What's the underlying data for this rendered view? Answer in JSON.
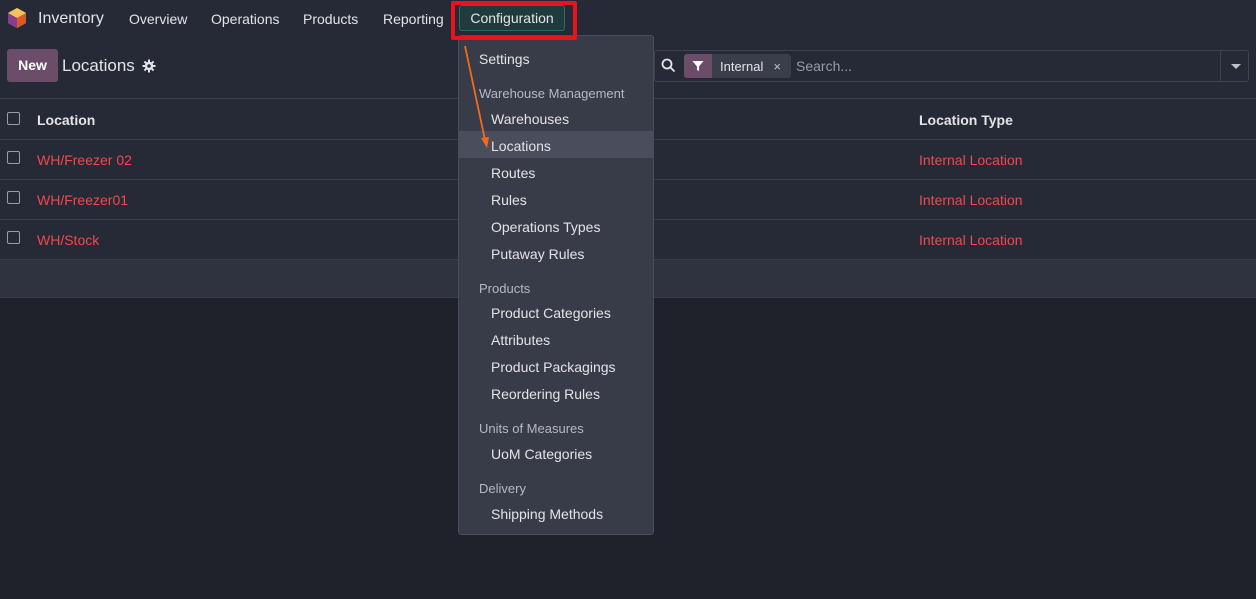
{
  "navbar": {
    "app_name": "Inventory",
    "menu": [
      "Overview",
      "Operations",
      "Products",
      "Reporting"
    ],
    "config_label": "Configuration"
  },
  "control_panel": {
    "new_label": "New",
    "title": "Locations",
    "facet_label": "Internal",
    "facet_remove": "×",
    "search_placeholder": "Search..."
  },
  "list": {
    "columns": [
      "Location",
      "Location Type"
    ],
    "rows": [
      {
        "location": "WH/Freezer 02",
        "type": "Internal Location"
      },
      {
        "location": "WH/Freezer01",
        "type": "Internal Location"
      },
      {
        "location": "WH/Stock",
        "type": "Internal Location"
      }
    ]
  },
  "dropdown": {
    "settings": "Settings",
    "sections": [
      {
        "header": "Warehouse Management",
        "items": [
          "Warehouses",
          "Locations",
          "Routes",
          "Rules",
          "Operations Types",
          "Putaway Rules"
        ]
      },
      {
        "header": "Products",
        "items": [
          "Product Categories",
          "Attributes",
          "Product Packagings",
          "Reordering Rules"
        ]
      },
      {
        "header": "Units of Measures",
        "items": [
          "UoM Categories"
        ]
      },
      {
        "header": "Delivery",
        "items": [
          "Shipping Methods"
        ]
      }
    ],
    "active_item": "Locations"
  },
  "colors": {
    "accent_purple": "#6b4d6a",
    "link_red": "#f0494b",
    "highlight_red": "#e8141d",
    "arrow_orange": "#f26b1d"
  }
}
